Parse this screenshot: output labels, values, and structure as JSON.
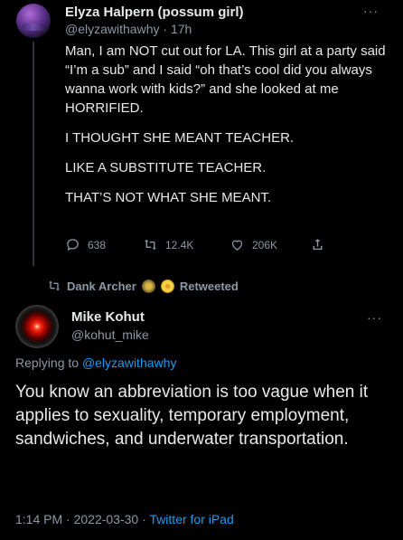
{
  "tweet1": {
    "display_name": "Elyza Halpern (possum girl)",
    "handle": "@elyzawithawhy",
    "separator": " · ",
    "time": "17h",
    "more": "···",
    "paragraphs": [
      "Man, I am NOT cut out for LA. This girl at a party said “I’m a sub” and I said “oh that’s cool did you always wanna work with kids?” and she looked at me HORRIFIED.",
      "I THOUGHT SHE MEANT TEACHER.",
      "LIKE A SUBSTITUTE TEACHER.",
      "THAT’S NOT WHAT SHE MEANT."
    ],
    "replies": "638",
    "retweets": "12.4K",
    "likes": "206K"
  },
  "retweeted_by": {
    "name": "Dank Archer",
    "suffix": "Retweeted"
  },
  "tweet2": {
    "display_name": "Mike Kohut",
    "handle": "@kohut_mike",
    "more": "···",
    "replying_prefix": "Replying to ",
    "replying_to": "@elyzawithawhy",
    "text": "You know an abbreviation is too vague when it applies to sexuality, temporary employment, sandwiches, and underwater transportation.",
    "time": "1:14 PM",
    "date": "2022-03-30",
    "separator": " · ",
    "source": "Twitter for iPad"
  },
  "colors": {
    "background": "#000000",
    "text": "#e7e9ea",
    "secondary": "#8b98a5",
    "link": "#1d9bf0"
  }
}
